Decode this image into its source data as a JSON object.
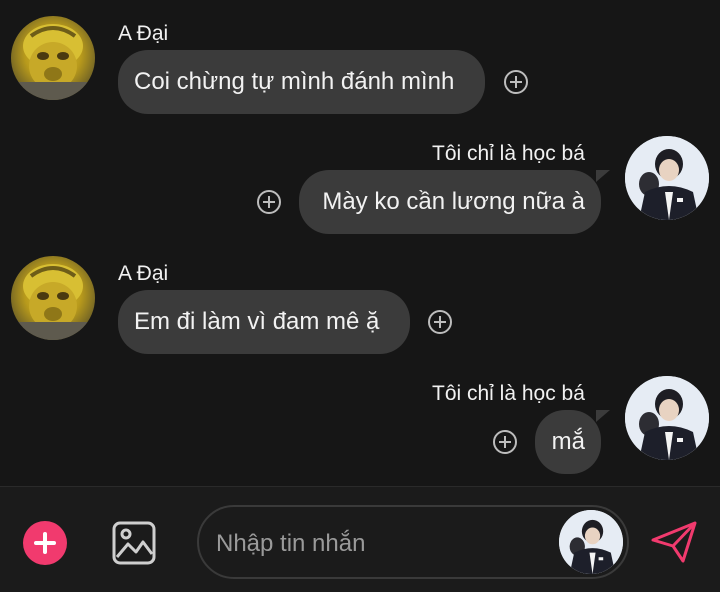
{
  "theme": {
    "accent": "#f13a6e",
    "bubble": "#3b3b3b",
    "background": "#161616"
  },
  "messages": [
    {
      "sender": "A Đại",
      "text": "Coi chừng tự mình đánh mình",
      "direction": "received",
      "avatar": "monkey-avatar"
    },
    {
      "sender": "Tôi chỉ là học bá",
      "text": "Mày ko cần lương nữa à",
      "direction": "sent",
      "avatar": "user-avatar"
    },
    {
      "sender": "A Đại",
      "text": "Em đi làm vì đam mê ặ",
      "direction": "received",
      "avatar": "monkey-avatar"
    },
    {
      "sender": "Tôi chỉ là học bá",
      "text": "mắ",
      "direction": "sent",
      "avatar": "user-avatar"
    }
  ],
  "composer": {
    "placeholder": "Nhập tin nhắn",
    "icons": [
      "plus-icon",
      "image-icon",
      "send-icon"
    ]
  }
}
